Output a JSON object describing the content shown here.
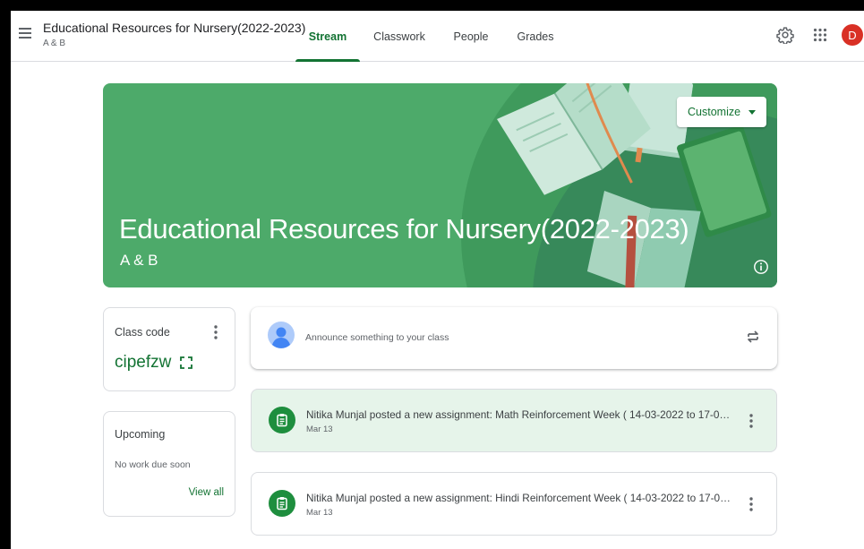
{
  "header": {
    "title": "Educational Resources for Nursery(2022-2023)",
    "section": "A & B",
    "tabs": [
      {
        "label": "Stream",
        "active": true
      },
      {
        "label": "Classwork",
        "active": false
      },
      {
        "label": "People",
        "active": false
      },
      {
        "label": "Grades",
        "active": false
      }
    ],
    "avatar_initial": "D",
    "icons": [
      "menu-icon",
      "gear-icon",
      "apps-grid-icon"
    ]
  },
  "banner": {
    "title": "Educational Resources for Nursery(2022-2023)",
    "section": "A & B",
    "customize_label": "Customize",
    "theme_color": "#4daa6a"
  },
  "class_code": {
    "label": "Class code",
    "code": "cipefzw"
  },
  "upcoming": {
    "title": "Upcoming",
    "empty_text": "No work due soon",
    "view_all_label": "View all"
  },
  "announce": {
    "placeholder": "Announce something to your class"
  },
  "posts": [
    {
      "title": "Nitika Munjal posted a new assignment: Math Reinforcement Week ( 14-03-2022 to 17-03-20...",
      "date": "Mar 13"
    },
    {
      "title": "Nitika Munjal posted a new assignment: Hindi Reinforcement Week ( 14-03-2022 to 17-03-20...",
      "date": "Mar 13"
    }
  ],
  "colors": {
    "accent": "#137333",
    "post_icon": "#1e8e3e",
    "highlight_post": "#e6f4ea",
    "avatar": "#d93025"
  }
}
